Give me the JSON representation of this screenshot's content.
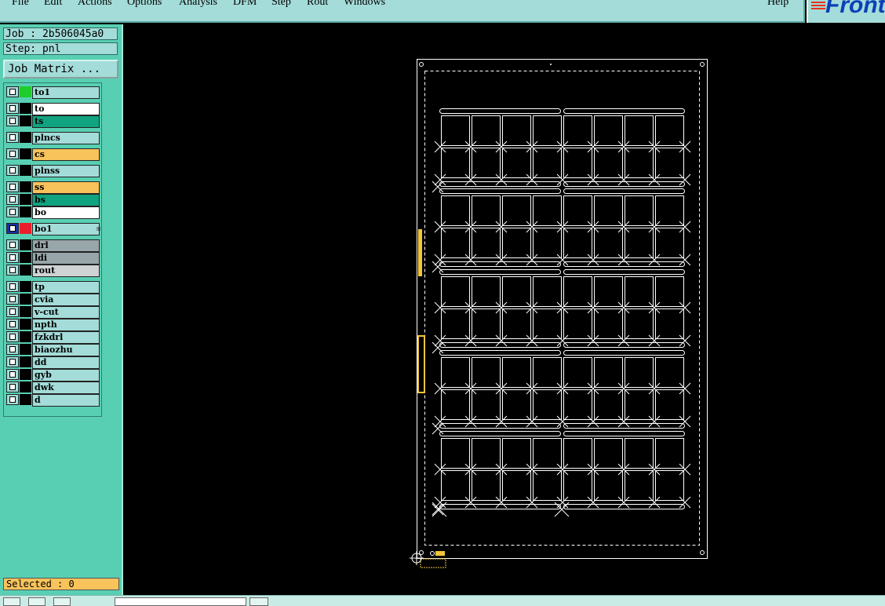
{
  "menu": [
    "File",
    "Edit",
    "Actions",
    "Options",
    "Analysis",
    "DFM",
    "Step",
    "Rout",
    "Windows"
  ],
  "help": "Help",
  "brand": "Front",
  "job_label": "Job : 2b506045a0",
  "step_label": "Step: pnl",
  "job_matrix": "Job Matrix ...",
  "layers": [
    {
      "name": "to1",
      "color": "#a3dcd9",
      "swatch": "#1fcc2d"
    },
    {
      "name": "to",
      "color": "#ffffff",
      "swatch": "#000000"
    },
    {
      "name": "ts",
      "color": "#10a37f",
      "swatch": "#000000"
    },
    {
      "name": "plncs",
      "color": "#a3dcd9",
      "swatch": "#000000"
    },
    {
      "name": "cs",
      "color": "#f9c35b",
      "swatch": "#000000"
    },
    {
      "name": "plnss",
      "color": "#a3dcd9",
      "swatch": "#000000"
    },
    {
      "name": "ss",
      "color": "#f9c35b",
      "swatch": "#000000"
    },
    {
      "name": "bs",
      "color": "#10a37f",
      "swatch": "#000000"
    },
    {
      "name": "bo",
      "color": "#ffffff",
      "swatch": "#000000"
    },
    {
      "name": "bo1",
      "color": "#a3dcd9",
      "swatch": "#ea1f2b",
      "check_color": "#1b2fa8"
    },
    {
      "name": "drl",
      "color": "#98a6aa",
      "swatch": "#000000"
    },
    {
      "name": "ldi",
      "color": "#98a6aa",
      "swatch": "#000000"
    },
    {
      "name": "rout",
      "color": "#cfd3d3",
      "swatch": "#000000"
    },
    {
      "name": "tp",
      "color": "#a3dcd9",
      "swatch": "#000000"
    },
    {
      "name": "cvia",
      "color": "#a3dcd9",
      "swatch": "#000000"
    },
    {
      "name": "v-cut",
      "color": "#a3dcd9",
      "swatch": "#000000"
    },
    {
      "name": "npth",
      "color": "#a3dcd9",
      "swatch": "#000000"
    },
    {
      "name": "fzkdrl",
      "color": "#a3dcd9",
      "swatch": "#000000"
    },
    {
      "name": "biaozhu",
      "color": "#a3dcd9",
      "swatch": "#000000"
    },
    {
      "name": "dd",
      "color": "#a3dcd9",
      "swatch": "#000000"
    },
    {
      "name": "gyb",
      "color": "#a3dcd9",
      "swatch": "#000000"
    },
    {
      "name": "dwk",
      "color": "#a3dcd9",
      "swatch": "#000000"
    },
    {
      "name": "d",
      "color": "#a3dcd9",
      "swatch": "#000000"
    }
  ],
  "selected": "Selected : 0",
  "colors": {
    "menu_bg": "#a3dcd9",
    "panel_bg": "#58cfb2",
    "canvas_bg": "#000000",
    "geometry": "#ffffff",
    "highlight": "#f2c53a"
  },
  "icons": [
    "save-icon",
    "undo-icon",
    "redo-icon"
  ]
}
